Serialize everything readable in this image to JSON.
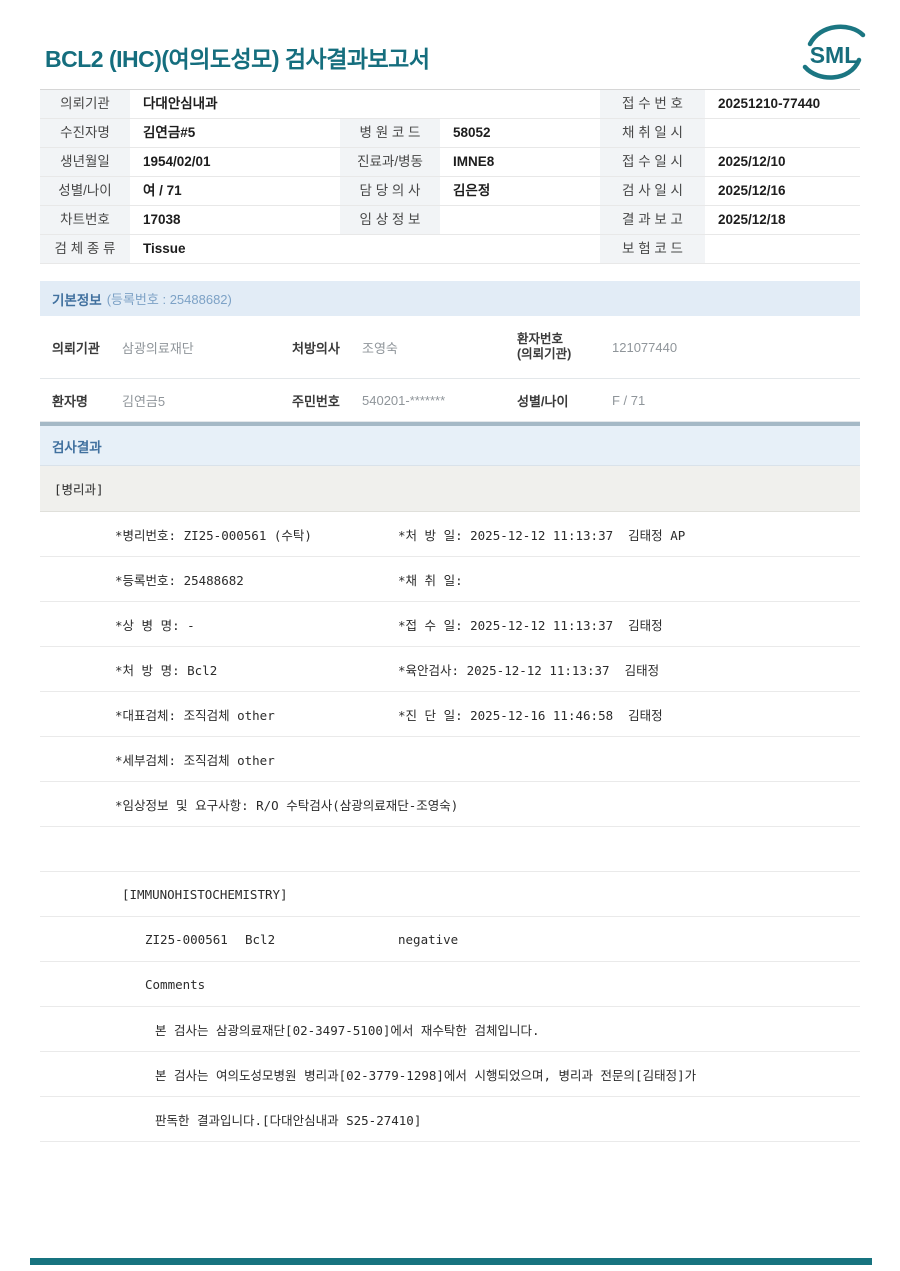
{
  "page": {
    "title": "BCL2 (IHC)(여의도성모) 검사결과보고서",
    "logo_text": "SML",
    "accent_teal": "#156e7e",
    "header_blue_bg": "#e2ecf6"
  },
  "patient_table": {
    "rows": [
      {
        "l1": "의뢰기관",
        "v1": "다대안심내과",
        "l3": "접 수 번 호",
        "v3": "20251210-77440"
      },
      {
        "l1": "수진자명",
        "v1": "김연금#5",
        "l2": "병 원 코 드",
        "v2": "58052",
        "l3": "채 취 일 시",
        "v3": ""
      },
      {
        "l1": "생년월일",
        "v1": "1954/02/01",
        "l2": "진료과/병동",
        "v2": "IMNE8",
        "l3": "접 수 일 시",
        "v3": "2025/12/10"
      },
      {
        "l1": "성별/나이",
        "v1": "여 / 71",
        "l2": "담 당 의 사",
        "v2": "김은정",
        "l3": "검 사 일 시",
        "v3": "2025/12/16"
      },
      {
        "l1": "차트번호",
        "v1": "17038",
        "l2": "임 상 정 보",
        "v2": "",
        "l3": "결 과 보 고",
        "v3": "2025/12/18"
      },
      {
        "l1": "검 체 종 류",
        "v1": "Tissue",
        "l3": "보 험 코 드",
        "v3": ""
      }
    ]
  },
  "basic_info": {
    "title": "기본정보",
    "reg_label": "(등록번호 : 25488682)",
    "row1": [
      {
        "label": "의뢰기관",
        "value": "삼광의료재단"
      },
      {
        "label": "처방의사",
        "value": "조영숙"
      },
      {
        "label": "환자번호",
        "label2": "(의뢰기관)",
        "value": "121077440"
      }
    ],
    "row2": [
      {
        "label": "환자명",
        "value": "김연금5"
      },
      {
        "label": "주민번호",
        "value": "540201-*******"
      },
      {
        "label": "성별/나이",
        "value": "F / 71"
      }
    ]
  },
  "results": {
    "title": "검사결과",
    "dept": "[병리과]",
    "rows": [
      {
        "left": "*병리번호: ZI25-000561 (수탁)",
        "right": "*처 방 일: 2025-12-12 11:13:37  김태정 AP"
      },
      {
        "left": "*등록번호: 25488682",
        "right": "*채 취 일:"
      },
      {
        "left": "*상 병 명: -",
        "right": "*접 수 일: 2025-12-12 11:13:37  김태정"
      },
      {
        "left": "*처 방 명: Bcl2",
        "right": "*육안검사: 2025-12-12 11:13:37  김태정"
      },
      {
        "left": "*대표검체: 조직검체 other",
        "right": "*진 단 일: 2025-12-16 11:46:58  김태정"
      },
      {
        "left": "*세부검체: 조직검체 other",
        "right": ""
      },
      {
        "left": "*임상정보 및 요구사항: R/O 수탁검사(삼광의료재단-조영숙)",
        "right": ""
      },
      {
        "empty": ""
      },
      {
        "text": "[IMMUNOHISTOCHEMISTRY]"
      },
      {
        "no": "ZI25-000561",
        "test": "Bcl2",
        "value": "negative"
      },
      {
        "text": "Comments"
      },
      {
        "text": "본 검사는 삼광의료재단[02-3497-5100]에서 재수탁한 검체입니다."
      },
      {
        "text": "본 검사는 여의도성모병원 병리과[02-3779-1298]에서 시행되었으며, 병리과 전문의[김태정]가"
      },
      {
        "text": "판독한 결과입니다.[다대안심내과 S25-27410]"
      }
    ]
  }
}
